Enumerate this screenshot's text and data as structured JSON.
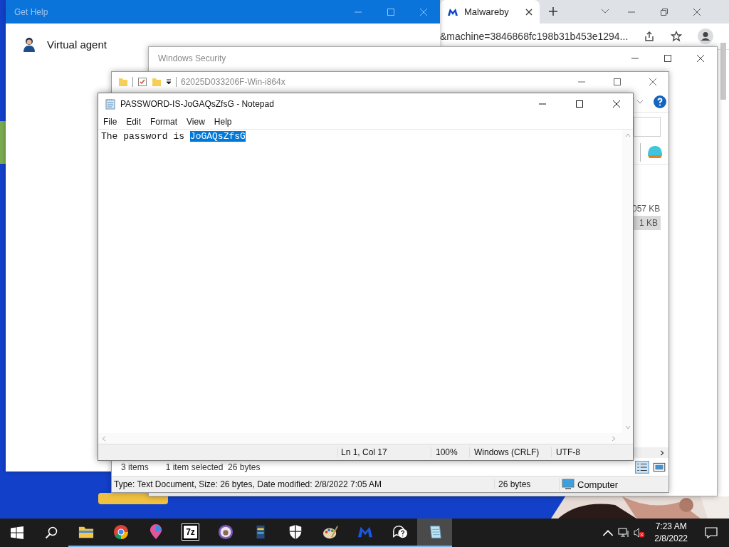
{
  "browser": {
    "tab": {
      "title": "Malwareby",
      "selected": true
    },
    "address": "&machine=3846868fc198b31b453e1294..."
  },
  "get_help": {
    "title": "Get Help",
    "agent": "Virtual agent"
  },
  "security": {
    "title": "Windows Security"
  },
  "explorer": {
    "title": "62025D033206F-Win-i864x",
    "sizes": [
      {
        "text": "057 KB",
        "selected": false
      },
      {
        "text": "1 KB",
        "selected": true
      }
    ],
    "status_items": "3 items",
    "status_selected": "1 item selected  26 bytes",
    "details": "Type: Text Document, Size: 26 bytes, Date modified: 2/8/2022 7:05 AM",
    "details_size": "26 bytes",
    "location": "Computer"
  },
  "notepad": {
    "title": "PASSWORD-IS-JoGAQsZfsG - Notepad",
    "menu": [
      "File",
      "Edit",
      "Format",
      "View",
      "Help"
    ],
    "text": "The password is ",
    "selection": "JoGAQsZfsG",
    "status": [
      "Ln 1, Col 17",
      "100%",
      "Windows (CRLF)",
      "UTF-8"
    ]
  },
  "taskbar": {
    "apps": [
      {
        "kind": "folder",
        "active": false
      },
      {
        "kind": "chrome",
        "active": false
      },
      {
        "kind": "pin",
        "active": false
      },
      {
        "kind": "archive",
        "label": "7z",
        "active": false
      },
      {
        "kind": "mascot",
        "active": false
      },
      {
        "kind": "book",
        "active": false
      },
      {
        "kind": "shield",
        "active": false
      },
      {
        "kind": "palette",
        "active": false
      },
      {
        "kind": "malware",
        "active": false
      },
      {
        "kind": "chat",
        "active": false
      },
      {
        "kind": "notepad",
        "active": true
      }
    ],
    "time": "7:23 AM",
    "date": "2/8/2022"
  }
}
